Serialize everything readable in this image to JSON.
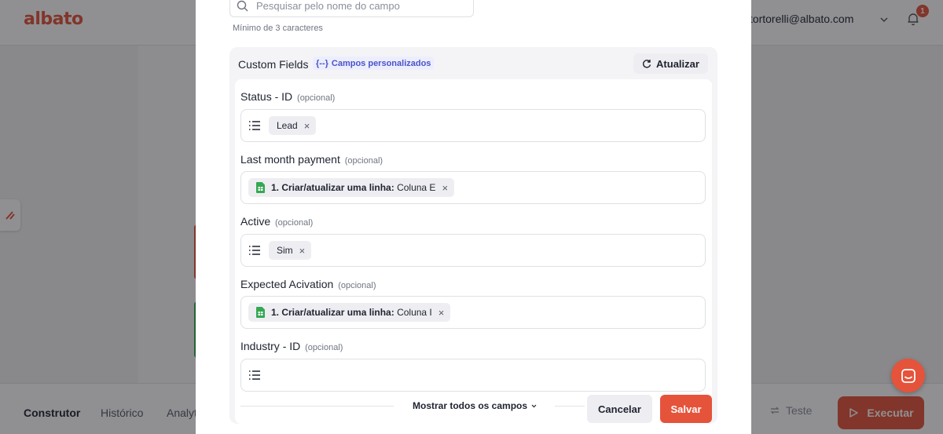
{
  "app": {
    "logo": "albato",
    "user_email": ".tortorelli@albato.com",
    "notification_count": "1",
    "accent_color": "#e5533b"
  },
  "bottom_nav": {
    "tabs": [
      "Construtor",
      "Histórico",
      "Analyt"
    ],
    "test_label": "Teste",
    "run_label": "Executar"
  },
  "modal": {
    "search": {
      "placeholder": "Pesquisar pelo nome do campo",
      "value": "",
      "hint": "Mínimo de 3 caracteres"
    },
    "section": {
      "title": "Custom Fields",
      "tag_icon": "{--}",
      "tag_label": "Campos personalizados",
      "refresh_label": "Atualizar"
    },
    "optional_label": "(opcional)",
    "fields": [
      {
        "label": "Status - ID",
        "chip_type": "list",
        "chip_text": "Lead"
      },
      {
        "label": "Last month payment",
        "chip_type": "sheet",
        "chip_bold": "1. Criar/atualizar uma linha:",
        "chip_text": "Coluna E"
      },
      {
        "label": "Active",
        "chip_type": "list",
        "chip_text": "Sim"
      },
      {
        "label": "Expected Acivation",
        "chip_type": "sheet",
        "chip_bold": "1. Criar/atualizar uma linha:",
        "chip_text": "Coluna I"
      },
      {
        "label": "Industry - ID",
        "chip_type": "empty"
      }
    ],
    "show_all_label": "Mostrar todos os campos",
    "cancel_label": "Cancelar",
    "save_label": "Salvar"
  }
}
